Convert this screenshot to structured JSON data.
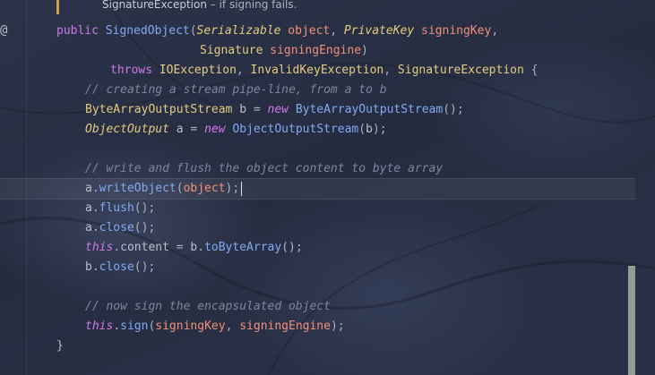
{
  "doc_comment": {
    "name": "SignatureException",
    "text": " – if signing fails."
  },
  "gutter": {
    "override_icon": "@"
  },
  "code": {
    "sig1": {
      "kw": "public",
      "name": "SignedObject",
      "open": "(",
      "p1_type": "Serializable",
      "p1_name": "object",
      "comma": ",",
      "p2_type": "PrivateKey",
      "p2_name": "signingKey",
      "comma2": ","
    },
    "sig2": {
      "p3_type": "Signature",
      "p3_name": "signingEngine",
      "close": ")"
    },
    "sig3": {
      "kw": "throws",
      "e1": "IOException",
      "c1": ",",
      "e2": "InvalidKeyException",
      "c2": ",",
      "e3": "SignatureException",
      "brace": "{"
    },
    "c1": "// creating a stream pipe-line, from a to b",
    "l1": {
      "type": "ByteArrayOutputStream",
      "var": "b",
      "eq": "=",
      "kw": "new",
      "cls": "ByteArrayOutputStream",
      "tail": "();"
    },
    "l2": {
      "type": "ObjectOutput",
      "var": "a",
      "eq": "=",
      "kw": "new",
      "cls": "ObjectOutputStream",
      "open": "(",
      "arg": "b",
      "tail": ");"
    },
    "c2": "// write and flush the object content to byte array",
    "l3": {
      "obj": "a",
      "dot": ".",
      "fn": "writeObject",
      "open": "(",
      "arg": "object",
      "tail": ");"
    },
    "l4": {
      "obj": "a",
      "dot": ".",
      "fn": "flush",
      "tail": "();"
    },
    "l5": {
      "obj": "a",
      "dot": ".",
      "fn": "close",
      "tail": "();"
    },
    "l6": {
      "kw": "this",
      "dot": ".",
      "field": "content",
      "eq": "=",
      "obj": "b",
      "dot2": ".",
      "fn": "toByteArray",
      "tail": "();"
    },
    "l7": {
      "obj": "b",
      "dot": ".",
      "fn": "close",
      "tail": "();"
    },
    "c3": "// now sign the encapsulated object",
    "l8": {
      "kw": "this",
      "dot": ".",
      "fn": "sign",
      "open": "(",
      "a1": "signingKey",
      "comma": ",",
      "a2": "signingEngine",
      "tail": ");"
    },
    "end": "}"
  },
  "colors": {
    "keyword": "#cc7ae6",
    "type": "#e3cc7f",
    "function": "#82aaf2",
    "variable": "#f0907a",
    "comment": "#7d869c"
  }
}
